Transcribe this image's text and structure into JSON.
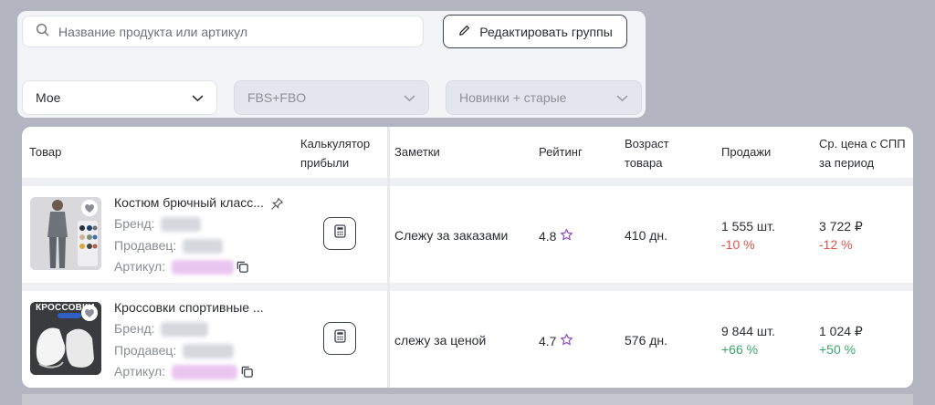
{
  "filters": {
    "search_placeholder": "Название продукта или артикул",
    "edit_groups_label": "Редактировать группы",
    "select_group": "Мое",
    "select_fulfillment": "FBS+FBO",
    "select_novelty": "Новинки + старые"
  },
  "table": {
    "headers": {
      "product": "Товар",
      "calc_line1": "Калькулятор",
      "calc_line2": "прибыли",
      "notes": "Заметки",
      "rating": "Рейтинг",
      "age_line1": "Возраст",
      "age_line2": "товара",
      "sales": "Продажи",
      "price_line1": "Ср. цена с СПП",
      "price_line2": "за период"
    },
    "rows": [
      {
        "name": "Костюм брючный класс...",
        "brand_label": "Бренд:",
        "seller_label": "Продавец:",
        "sku_label": "Артикул:",
        "note": "Слежу за заказами",
        "rating": "4.8",
        "age": "410 дн.",
        "sales": "1 555 шт.",
        "sales_change": "-10 %",
        "price": "3 722 ₽",
        "price_change": "-12 %"
      },
      {
        "name": "Кроссовки спортивные ...",
        "thumb_caption": "КРОССОВКИ",
        "brand_label": "Бренд:",
        "seller_label": "Продавец:",
        "sku_label": "Артикул:",
        "note": "слежу за ценой",
        "rating": "4.7",
        "age": "576 дн.",
        "sales": "9 844 шт.",
        "sales_change": "+66 %",
        "price": "1 024 ₽",
        "price_change": "+50 %"
      }
    ]
  },
  "colors": {
    "negative": "#e2534a",
    "positive": "#3aa56b",
    "star": "#8b4fc9"
  }
}
